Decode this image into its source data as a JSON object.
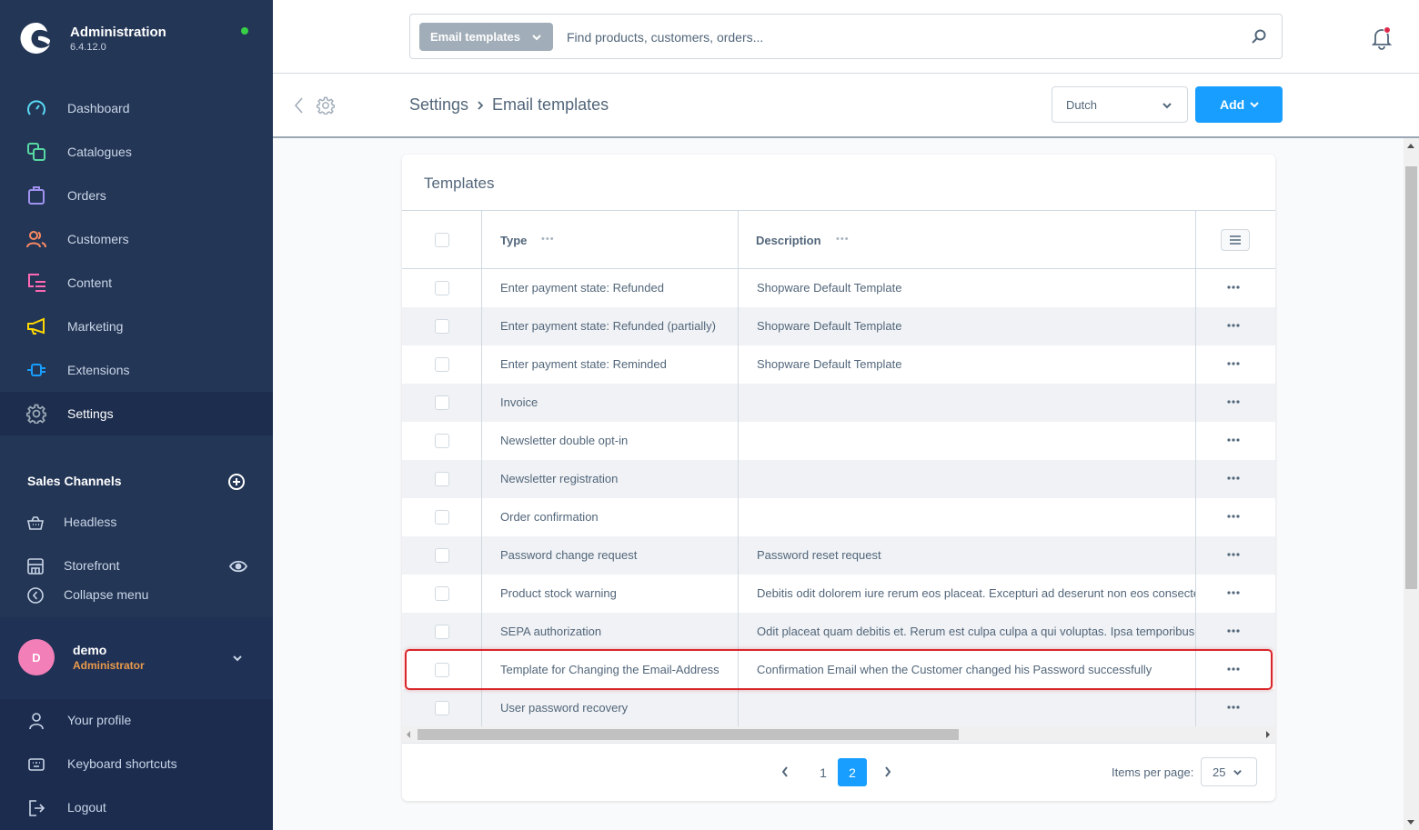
{
  "app": {
    "title": "Administration",
    "version": "6.4.12.0",
    "status_color": "#37d046"
  },
  "sidebar": {
    "items": [
      {
        "label": "Dashboard",
        "icon": "dashboard-icon",
        "color": "#57d9f5"
      },
      {
        "label": "Catalogues",
        "icon": "catalogues-icon",
        "color": "#57d9a3"
      },
      {
        "label": "Orders",
        "icon": "orders-icon",
        "color": "#a092f0"
      },
      {
        "label": "Customers",
        "icon": "customers-icon",
        "color": "#f88962"
      },
      {
        "label": "Content",
        "icon": "content-icon",
        "color": "#ff68b4"
      },
      {
        "label": "Marketing",
        "icon": "marketing-icon",
        "color": "#ffd700"
      },
      {
        "label": "Extensions",
        "icon": "extensions-icon",
        "color": "#189eff"
      },
      {
        "label": "Settings",
        "icon": "settings-icon",
        "color": "#9aa8b5",
        "active": true
      }
    ],
    "sales_channels": {
      "heading": "Sales Channels",
      "items": [
        {
          "label": "Headless",
          "icon": "basket-icon"
        },
        {
          "label": "Storefront",
          "icon": "storefront-icon"
        }
      ]
    },
    "collapse_label": "Collapse menu",
    "user": {
      "initial": "D",
      "name": "demo",
      "role": "Administrator"
    },
    "user_menu": [
      {
        "label": "Your profile",
        "icon": "user-icon"
      },
      {
        "label": "Keyboard shortcuts",
        "icon": "keyboard-icon"
      },
      {
        "label": "Logout",
        "icon": "logout-icon"
      }
    ]
  },
  "topbar": {
    "search_type": "Email templates",
    "search_placeholder": "Find products, customers, orders..."
  },
  "smartbar": {
    "breadcrumb": [
      "Settings",
      "Email templates"
    ],
    "language": "Dutch",
    "add_label": "Add"
  },
  "card": {
    "title": "Templates",
    "columns": [
      "Type",
      "Description"
    ],
    "rows": [
      {
        "type": "Enter payment state: Refunded",
        "description": "Shopware Default Template"
      },
      {
        "type": "Enter payment state: Refunded (partially)",
        "description": "Shopware Default Template"
      },
      {
        "type": "Enter payment state: Reminded",
        "description": "Shopware Default Template"
      },
      {
        "type": "Invoice",
        "description": ""
      },
      {
        "type": "Newsletter double opt-in",
        "description": ""
      },
      {
        "type": "Newsletter registration",
        "description": ""
      },
      {
        "type": "Order confirmation",
        "description": ""
      },
      {
        "type": "Password change request",
        "description": "Password reset request"
      },
      {
        "type": "Product stock warning",
        "description": "Debitis odit dolorem iure rerum eos placeat. Excepturi ad deserunt non eos consectetur"
      },
      {
        "type": "SEPA authorization",
        "description": "Odit placeat quam debitis et. Rerum est culpa culpa a qui voluptas. Ipsa temporibus"
      },
      {
        "type": "Template for Changing the Email-Address",
        "description": "Confirmation Email when the Customer changed his Password successfully",
        "highlighted": true
      },
      {
        "type": "User password recovery",
        "description": ""
      }
    ],
    "pagination": {
      "pages": [
        "1",
        "2"
      ],
      "current": "2",
      "items_per_page_label": "Items per page:",
      "items_per_page": "25"
    }
  },
  "colors": {
    "sidebar_bg": "#243656",
    "accent": "#189eff",
    "highlight_border": "#d9262b",
    "avatar_bg": "#f37fb8",
    "role_color": "#ea9a4a"
  }
}
